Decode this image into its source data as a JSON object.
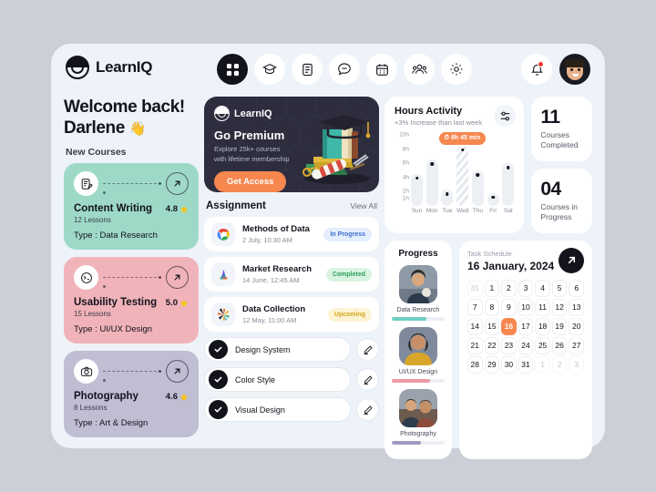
{
  "theme": {
    "page_bg": "#ccced8",
    "app_bg": "#eef3f9",
    "accent": "#f5874f",
    "dark": "#13131c"
  },
  "header": {
    "brand": "LearnIQ",
    "nav": [
      {
        "icon": "grid-icon",
        "name": "dashboard",
        "active": true
      },
      {
        "icon": "graduation-cap-icon",
        "name": "courses",
        "active": false
      },
      {
        "icon": "document-icon",
        "name": "documents",
        "active": false
      },
      {
        "icon": "chat-icon",
        "name": "messages",
        "active": false
      },
      {
        "icon": "calendar-icon",
        "name": "calendar",
        "active": false
      },
      {
        "icon": "users-icon",
        "name": "community",
        "active": false
      },
      {
        "icon": "gear-icon",
        "name": "settings",
        "active": false
      }
    ],
    "notification_icon": "bell-icon",
    "has_notification": true,
    "avatar_label": "Darlene"
  },
  "left": {
    "welcome_line1": "Welcome back!",
    "welcome_line2": "Darlene",
    "wave": "👋",
    "section_label": "New Courses",
    "courses": [
      {
        "title": "Content Writing",
        "lessons": "12 Lessons",
        "type": "Type : Data Research",
        "rating": "4.8",
        "bg": "#9ed9c8",
        "icon": "notes-pen-icon"
      },
      {
        "title": "Usability Testing",
        "lessons": "15 Lessons",
        "type": "Type : UI/UX Design",
        "rating": "5.0",
        "bg": "#f0b3b9",
        "icon": "terminal-face-icon"
      },
      {
        "title": "Photography",
        "lessons": "8 Lessons",
        "type": "Type : Art & Design",
        "rating": "4.6",
        "bg": "#c0bed3",
        "icon": "camera-icon"
      }
    ]
  },
  "promo": {
    "brand": "LearnIQ",
    "title": "Go Premium",
    "subtitle": "Explore 25k+ courses\nwith lifetime membership",
    "button": "Get Access",
    "bg": "#2d2d3e",
    "button_color": "#f5874f",
    "art": "graduation-cap-books-icon"
  },
  "assignment": {
    "heading": "Assignment",
    "view_all": "View All",
    "items": [
      {
        "name": "Methods of Data",
        "date": "2 July, 10:30 AM",
        "status": "In Progress",
        "status_bg": "#e4eefc",
        "status_fg": "#3d6fd1",
        "icon": "chrome-ring-icon"
      },
      {
        "name": "Market Research",
        "date": "14 June, 12:45 AM",
        "status": "Completed",
        "status_bg": "#d9f5e1",
        "status_fg": "#2e9c5c",
        "icon": "adobe-triangle-icon"
      },
      {
        "name": "Data Collection",
        "date": "12 May, 11:00 AM",
        "status": "Upcoming",
        "status_bg": "#fdf4d3",
        "status_fg": "#d6a520",
        "icon": "pinwheel-icon"
      }
    ]
  },
  "tasks": {
    "items": [
      {
        "label": "Design System",
        "checked": true,
        "edit_icon": "pencil-icon"
      },
      {
        "label": "Color Style",
        "checked": true,
        "edit_icon": "pencil-icon"
      },
      {
        "label": "Visual Design",
        "checked": true,
        "edit_icon": "pencil-icon"
      }
    ]
  },
  "chart_data": {
    "type": "bar",
    "title": "Hours Activity",
    "subtitle": "+3% Increase than last week",
    "categories": [
      "Sun",
      "Mon",
      "Tue",
      "Wed",
      "Thu",
      "Fri",
      "Sat"
    ],
    "values": [
      4.5,
      6.5,
      2.3,
      8.5,
      5.0,
      1.8,
      6.0
    ],
    "ylim": [
      0,
      10
    ],
    "ytick_labels": [
      "10h",
      "8h",
      "6h",
      "4h",
      "2h",
      "1h"
    ],
    "ytick_values": [
      10,
      8,
      6,
      4,
      2,
      1
    ],
    "xlabel": "",
    "ylabel": "",
    "grid": false,
    "legend": false,
    "highlight_index": 3,
    "highlight_label": "8h 45 min",
    "highlight_color": "#f5874f",
    "bar_color": "#eceff4",
    "options_icon": "sliders-icon"
  },
  "stats": [
    {
      "value": "11",
      "label": "Courses\nCompleted"
    },
    {
      "value": "04",
      "label": "Courses in\nProgress"
    }
  ],
  "progress": {
    "title": "Progress",
    "items": [
      {
        "label": "Data Research",
        "percent": 65,
        "color": "#6fcfc0",
        "thumb": "person-photo-1"
      },
      {
        "label": "UI/UX Design",
        "percent": 72,
        "color": "#ef9aa5",
        "thumb": "person-photo-2"
      },
      {
        "label": "Photography",
        "percent": 55,
        "color": "#9d9cc0",
        "thumb": "person-photo-3"
      }
    ]
  },
  "calendar": {
    "kicker": "Task Schedule",
    "date": "16 January, 2024",
    "go_icon": "arrow-up-right-icon",
    "days": [
      {
        "d": "31",
        "muted": true
      },
      {
        "d": "1"
      },
      {
        "d": "2"
      },
      {
        "d": "3"
      },
      {
        "d": "4"
      },
      {
        "d": "5"
      },
      {
        "d": "6"
      },
      {
        "d": "7"
      },
      {
        "d": "8"
      },
      {
        "d": "9"
      },
      {
        "d": "10"
      },
      {
        "d": "11"
      },
      {
        "d": "12"
      },
      {
        "d": "13"
      },
      {
        "d": "14"
      },
      {
        "d": "15"
      },
      {
        "d": "16",
        "today": true
      },
      {
        "d": "17"
      },
      {
        "d": "18"
      },
      {
        "d": "19"
      },
      {
        "d": "20"
      },
      {
        "d": "21"
      },
      {
        "d": "22"
      },
      {
        "d": "23"
      },
      {
        "d": "24"
      },
      {
        "d": "25"
      },
      {
        "d": "26"
      },
      {
        "d": "27"
      },
      {
        "d": "28"
      },
      {
        "d": "29"
      },
      {
        "d": "30"
      },
      {
        "d": "31"
      },
      {
        "d": "1",
        "muted": true
      },
      {
        "d": "2",
        "muted": true
      },
      {
        "d": "3",
        "muted": true
      }
    ]
  }
}
